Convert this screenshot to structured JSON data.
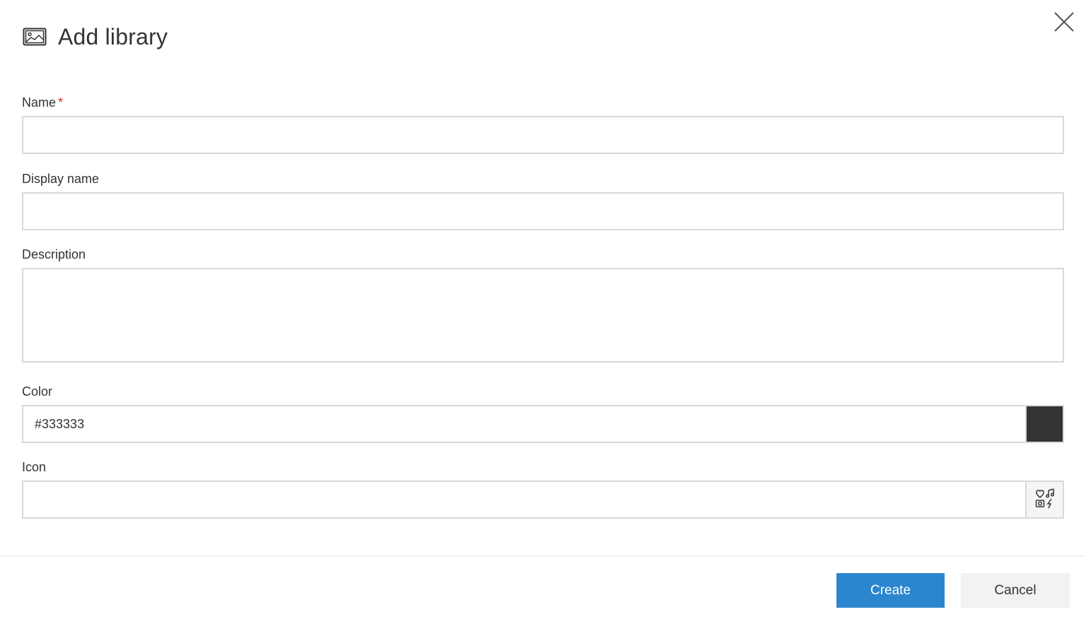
{
  "dialog": {
    "title": "Add library",
    "title_icon": "image-icon",
    "close_icon": "close-icon"
  },
  "form": {
    "name": {
      "label": "Name",
      "required_marker": "*",
      "value": ""
    },
    "display_name": {
      "label": "Display name",
      "value": ""
    },
    "description": {
      "label": "Description",
      "value": ""
    },
    "color": {
      "label": "Color",
      "value": "#333333",
      "swatch_color": "#333333"
    },
    "icon": {
      "label": "Icon",
      "value": "",
      "picker_icon": "icon-picker-icon"
    }
  },
  "footer": {
    "create_label": "Create",
    "cancel_label": "Cancel"
  },
  "colors": {
    "primary": "#2b86cf",
    "required": "#d32f2f",
    "border": "#d9d9d9"
  }
}
